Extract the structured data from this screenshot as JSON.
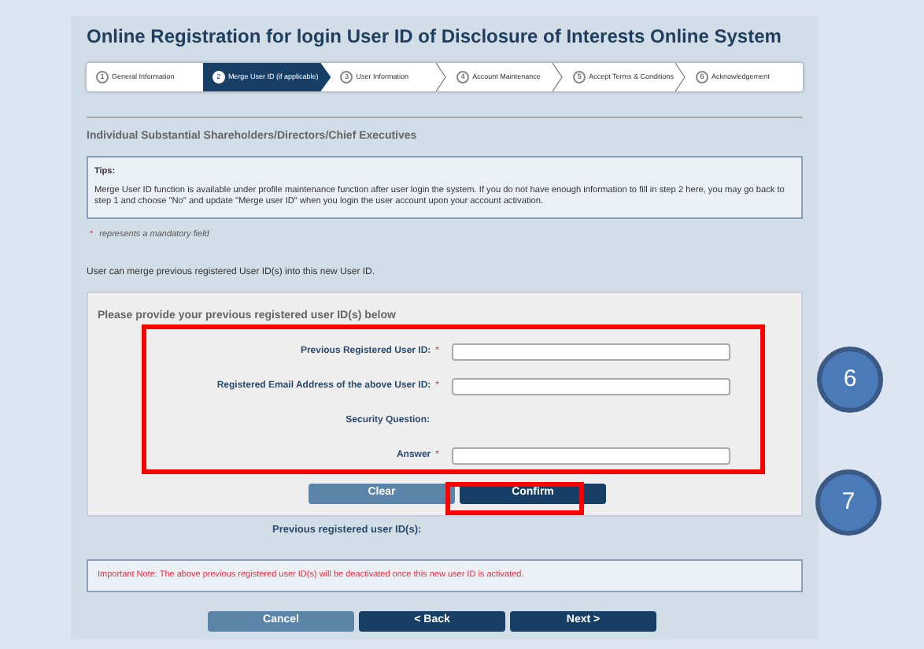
{
  "title": "Online Registration for login User ID of Disclosure of Interests Online System",
  "steps": [
    {
      "number": "1",
      "label": "General Information",
      "selected": false
    },
    {
      "number": "2",
      "label": "Merge User ID (if applicable)",
      "selected": true
    },
    {
      "number": "3",
      "label": "User Information",
      "selected": false
    },
    {
      "number": "4",
      "label": "Account Maintenance",
      "selected": false
    },
    {
      "number": "5",
      "label": "Accept Terms & Conditions",
      "selected": false
    },
    {
      "number": "6",
      "label": "Acknowledgement",
      "selected": false
    }
  ],
  "section_heading": "Individual Substantial Shareholders/Directors/Chief Executives",
  "tips": {
    "title": "Tips:",
    "text": "Merge User ID function is available under profile maintenance function after user login the system. If you do not have enough information to fill in step 2 here, you may go back to step 1 and choose \"No\" and update \"Merge user ID\" when you login the user account upon your account activation."
  },
  "mandatory_note": {
    "mark": "*",
    "text": "represents a mandatory field"
  },
  "intro": "User can merge previous registered User ID(s) into this new User ID.",
  "form": {
    "heading": "Please provide your previous registered user ID(s) below",
    "fields": [
      {
        "kind": "input",
        "label": "Previous Registered User ID:",
        "required": true
      },
      {
        "kind": "input",
        "label": "Registered Email Address of the above User ID:",
        "required": true
      },
      {
        "kind": "text",
        "label": "Security Question:",
        "required": false
      },
      {
        "kind": "input",
        "label": "Answer",
        "required": true
      }
    ],
    "buttons": [
      {
        "label": "Clear",
        "primary": false
      },
      {
        "label": "Confirm",
        "primary": true
      }
    ]
  },
  "previous_ids_label": "Previous registered user ID(s):",
  "important_note": "Important Note: The above previous registered user ID(s) will be deactivated once this new user ID is activated.",
  "nav_buttons": [
    {
      "label": "Cancel",
      "primary": false
    },
    {
      "label": "< Back",
      "primary": true
    },
    {
      "label": "Next >",
      "primary": true
    }
  ],
  "callouts": [
    "6",
    "7"
  ]
}
